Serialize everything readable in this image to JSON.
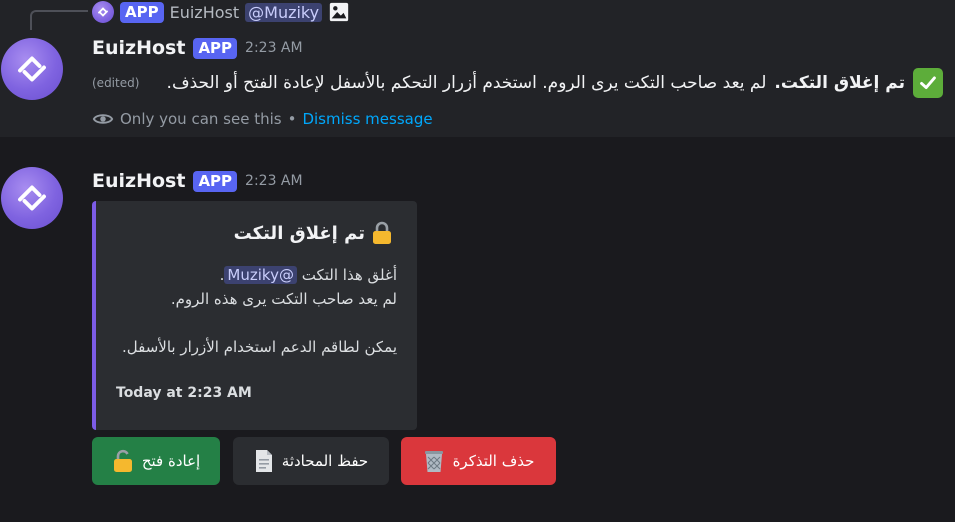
{
  "reply": {
    "badge": "APP",
    "name": "EuizHost",
    "mention": "@Muziky"
  },
  "message1": {
    "author": "EuizHost",
    "badge": "APP",
    "time": "2:23 AM",
    "bold_text": "تم إغلاق التكت.",
    "text": "لم يعد صاحب التكت يرى الروم. استخدم أزرار التحكم بالأسفل لإعادة الفتح أو الحذف.",
    "edited": "(edited)",
    "only_you": "Only you can see this",
    "separator": "•",
    "dismiss": "Dismiss message"
  },
  "message2": {
    "author": "EuizHost",
    "badge": "APP",
    "time": "2:23 AM",
    "embed": {
      "title": "تم إغلاق التكت",
      "line1_prefix": "أغلق هذا التكت",
      "mention": "@Muziky",
      "line1_suffix": ".",
      "line2": "لم يعد صاحب التكت يرى هذه الروم.",
      "line3": "يمكن لطاقم الدعم استخدام الأزرار بالأسفل.",
      "footer": "Today at 2:23 AM",
      "accent_color": "#7c5ce6"
    }
  },
  "buttons": [
    {
      "label": "إعادة فتح",
      "icon": "unlock-icon",
      "color": "#248046"
    },
    {
      "label": "حفظ المحادثة",
      "icon": "document-icon",
      "color": "#2b2d31"
    },
    {
      "label": "حذف التذكرة",
      "icon": "wastebasket-icon",
      "color": "#da373c"
    }
  ]
}
